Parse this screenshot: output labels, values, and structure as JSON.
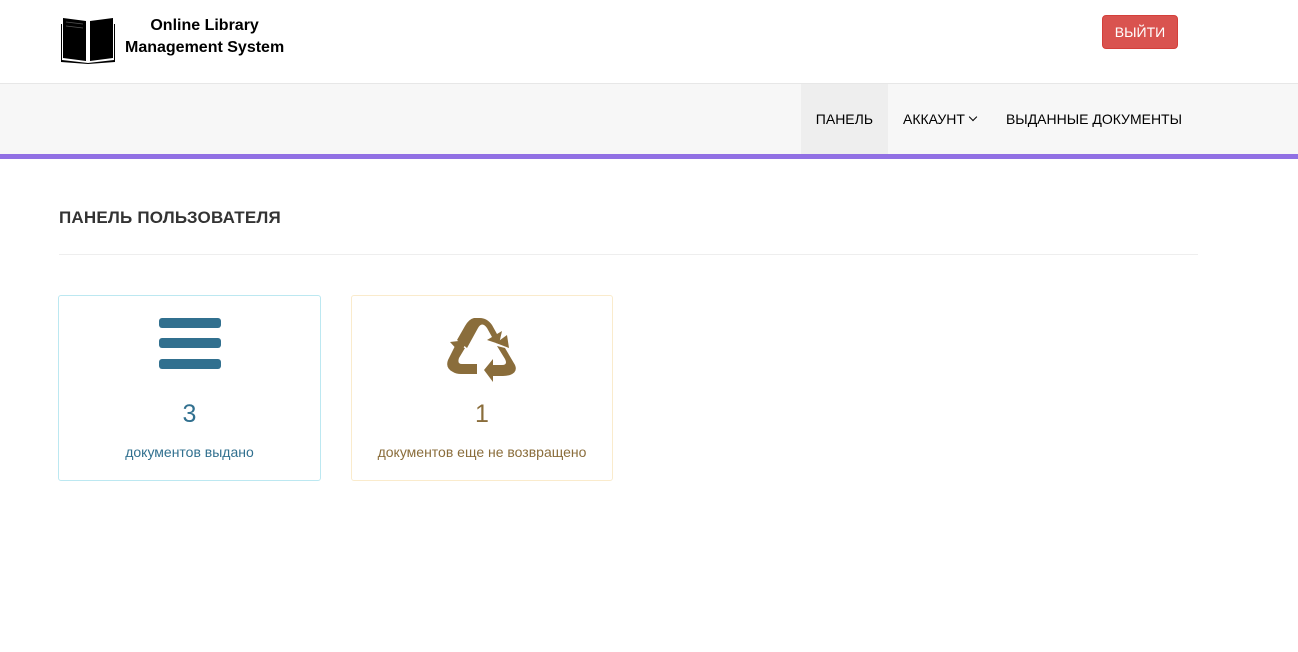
{
  "header": {
    "brand_line1": "Online Library",
    "brand_line2": "Management System",
    "logo_icon": "open-book-icon",
    "logout_label": "ВЫЙТИ"
  },
  "nav": {
    "items": [
      {
        "label": "ПАНЕЛЬ",
        "active": true
      },
      {
        "label": "АККАУНТ",
        "has_dropdown": true
      },
      {
        "label": "ВЫДАННЫЕ ДОКУМЕНТЫ"
      }
    ]
  },
  "main": {
    "title": "ПАНЕЛЬ ПОЛЬЗОВАТЕЛЯ",
    "cards": [
      {
        "icon": "bars-icon",
        "count": "3",
        "label": "документов выдано",
        "color": "#31708f"
      },
      {
        "icon": "recycle-icon",
        "count": "1",
        "label": "документов еще не возвращено",
        "color": "#8a6d3b"
      }
    ]
  },
  "colors": {
    "accent_bar": "#9170e4",
    "logout_button": "#d9534f",
    "nav_background": "#f7f7f7",
    "info_border": "#bce8f1",
    "warning_border": "#faebcc"
  }
}
